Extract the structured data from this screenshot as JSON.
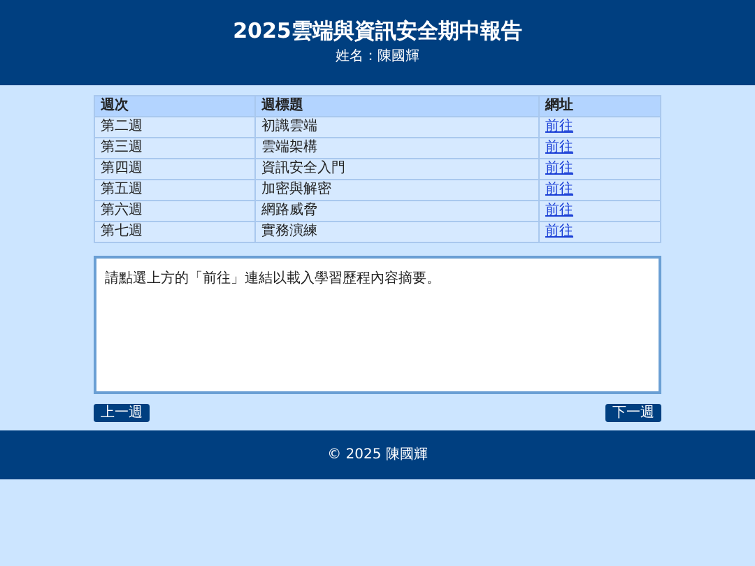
{
  "header": {
    "title": "2025雲端與資訊安全期中報告",
    "subtitle": "姓名：陳國輝"
  },
  "table": {
    "columns": [
      "週次",
      "週標題",
      "網址"
    ],
    "rows": [
      {
        "week": "第二週",
        "title": "初識雲端",
        "link": "前往"
      },
      {
        "week": "第三週",
        "title": "雲端架構",
        "link": "前往"
      },
      {
        "week": "第四週",
        "title": "資訊安全入門",
        "link": "前往"
      },
      {
        "week": "第五週",
        "title": "加密與解密",
        "link": "前往"
      },
      {
        "week": "第六週",
        "title": "網路威脅",
        "link": "前往"
      },
      {
        "week": "第七週",
        "title": "實務演練",
        "link": "前往"
      }
    ]
  },
  "content": {
    "text": "請點選上方的「前往」連結以載入學習歷程內容摘要。"
  },
  "nav": {
    "prev": "上一週",
    "next": "下一週"
  },
  "footer": {
    "text": "© 2025 陳國輝"
  }
}
